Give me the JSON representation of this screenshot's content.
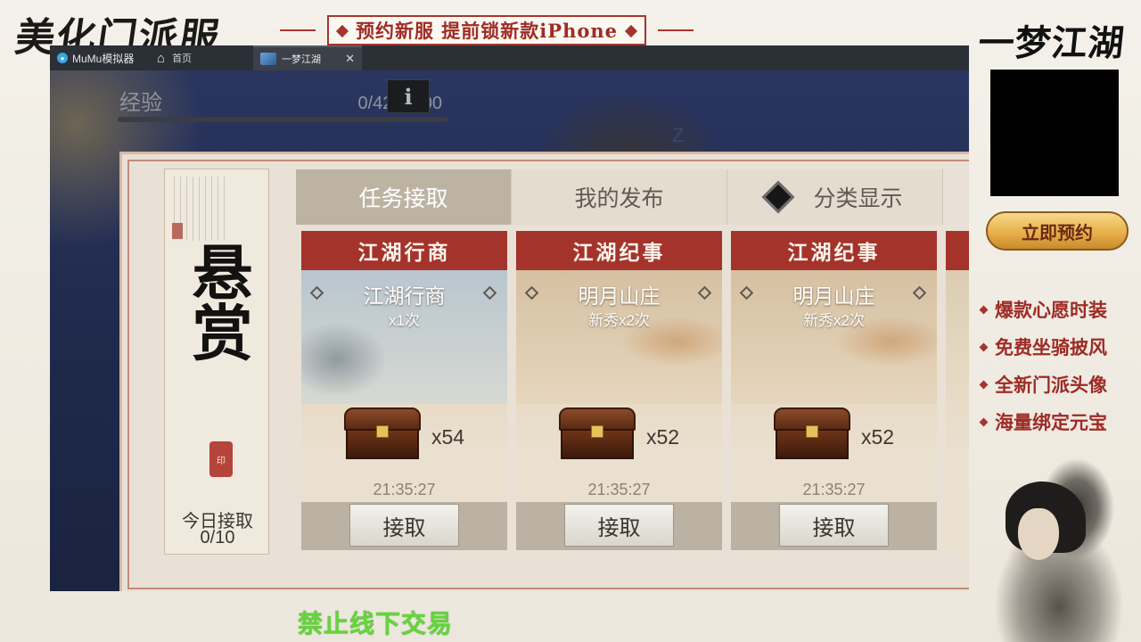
{
  "overlay": {
    "title": "美化门派服",
    "banner": "预约新服  提前锁新款iPhone",
    "game_logo": "一梦江湖",
    "reserve_label": "立即预约",
    "promos": [
      "爆款心愿时装",
      "免费坐骑披风",
      "全新门派头像",
      "海量绑定元宝"
    ],
    "notice": "禁止线下交易"
  },
  "emulator": {
    "app_name": "MuMu模拟器",
    "home_label": "首页",
    "tab_label": "一梦江湖"
  },
  "game": {
    "exp_label": "经验",
    "exp_value": "0/4200000",
    "exp_progress": 0,
    "info_label": "i",
    "sleep_mark": "Z",
    "bounty": {
      "side_title": "悬赏",
      "today_label": "今日接取",
      "today_count": "0/10",
      "tabs": [
        {
          "label": "任务接取",
          "active": true
        },
        {
          "label": "我的发布",
          "active": false
        },
        {
          "label": "分类显示",
          "active": false,
          "icon": "diamond-icon"
        }
      ],
      "cards": [
        {
          "category": "江湖行商",
          "place": "江湖行商",
          "requirement": "x1次",
          "reward_icon": "treasure-chest-icon",
          "reward_count": "x54",
          "timer": "21:35:27",
          "action": "接取"
        },
        {
          "category": "江湖纪事",
          "place": "明月山庄",
          "requirement": "新秀x2次",
          "reward_icon": "treasure-chest-icon",
          "reward_count": "x52",
          "timer": "21:35:27",
          "action": "接取"
        },
        {
          "category": "江湖纪事",
          "place": "明月山庄",
          "requirement": "新秀x2次",
          "reward_icon": "treasure-chest-icon",
          "reward_count": "x52",
          "timer": "21:35:27",
          "action": "接取"
        }
      ]
    }
  }
}
